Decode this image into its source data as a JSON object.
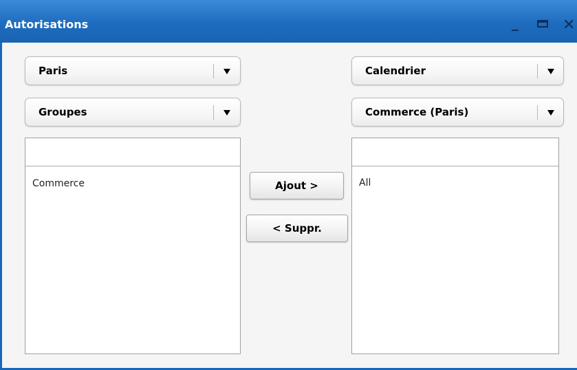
{
  "window": {
    "title": "Autorisations",
    "controls": {
      "minimize": "_",
      "close": "✕"
    }
  },
  "left": {
    "location_select": {
      "value": "Paris"
    },
    "type_select": {
      "value": "Groupes"
    },
    "list": {
      "header": "",
      "items": [
        "Commerce"
      ]
    }
  },
  "right": {
    "resource_select": {
      "value": "Calendrier"
    },
    "target_select": {
      "value": "Commerce (Paris)"
    },
    "list": {
      "header": "",
      "items": [
        "All"
      ]
    }
  },
  "actions": {
    "add_label": "Ajout >",
    "remove_label": "< Suppr."
  },
  "colors": {
    "titlebar": "#1e6cbf",
    "window_border": "#1a67b8",
    "background": "#f5f5f5"
  }
}
